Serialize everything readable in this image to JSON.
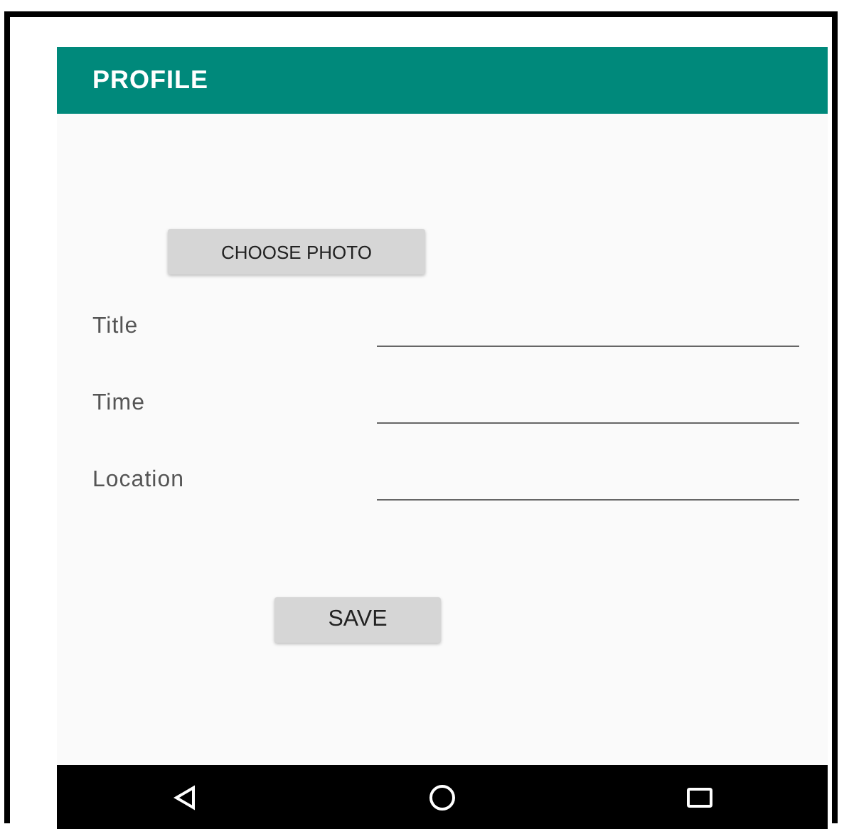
{
  "app_bar": {
    "title": "PROFILE"
  },
  "photo_button": "CHOOSE PHOTO",
  "fields": [
    {
      "label": "Title"
    },
    {
      "label": "Time"
    },
    {
      "label": "Location"
    }
  ],
  "save_button": "SAVE",
  "nav_bar": {
    "buttons": [
      {
        "kind": "back"
      },
      {
        "kind": "home"
      },
      {
        "kind": "recents"
      }
    ]
  }
}
